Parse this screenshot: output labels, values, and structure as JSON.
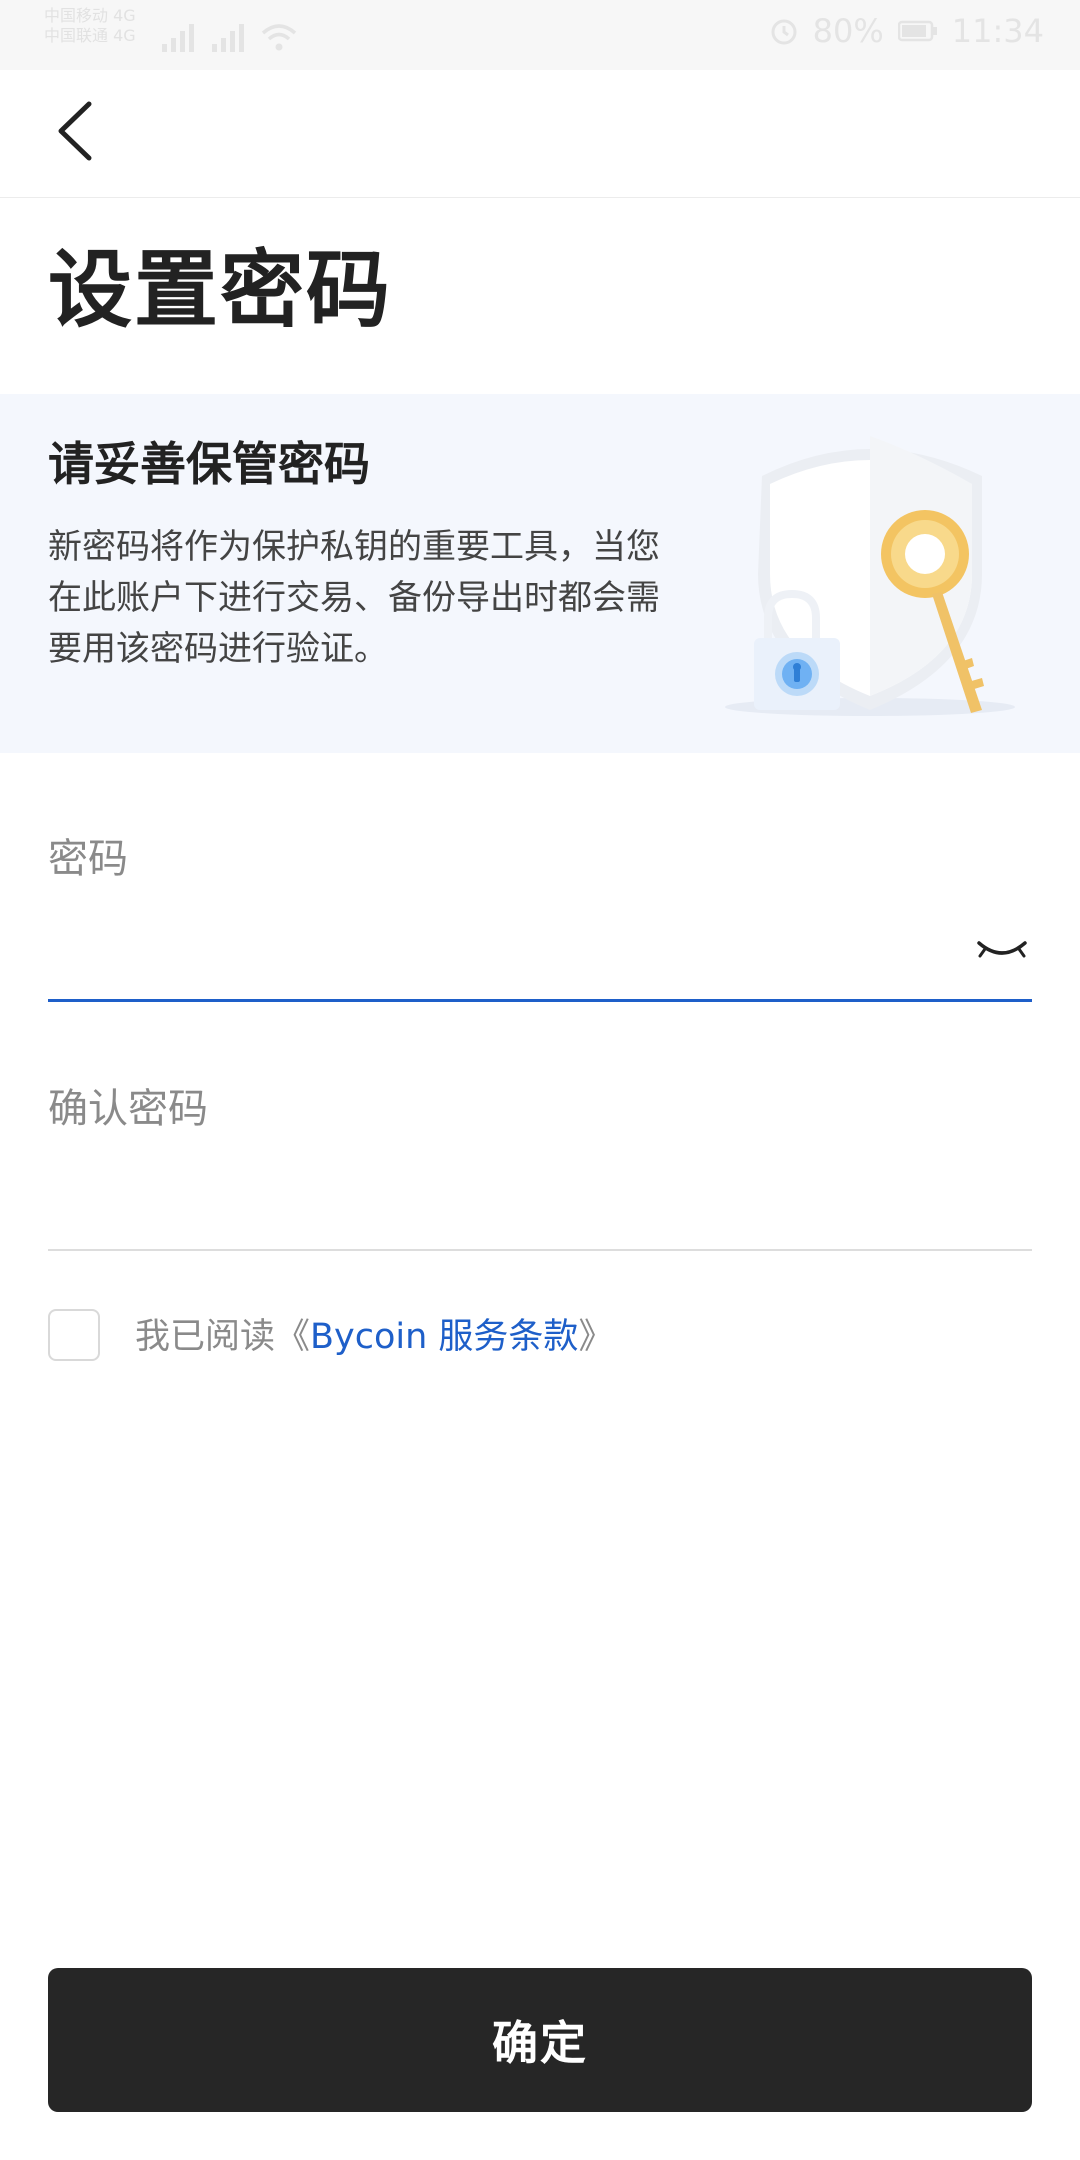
{
  "status_bar": {
    "carrier_line1": "中国移动 4G",
    "carrier_line2": "中国联通 4G",
    "battery": "80%",
    "time": "11:34"
  },
  "nav": {
    "back_icon": "chevron-left-icon"
  },
  "page": {
    "title": "设置密码"
  },
  "info_card": {
    "heading": "请妥善保管密码",
    "body": "新密码将作为保护私钥的重要工具，当您在此账户下进行交易、备份导出时都会需要用该密码进行验证。",
    "illustration_icon": "shield-key-lock-icon"
  },
  "form": {
    "password_label": "密码",
    "password_value": "",
    "confirm_label": "确认密码",
    "confirm_value": "",
    "eye_icon": "eye-closed-icon",
    "accent_color": "#1e5fc9"
  },
  "terms": {
    "prefix": "我已阅读《",
    "link": "Bycoin 服务条款",
    "suffix": "》",
    "checked": false
  },
  "actions": {
    "confirm_label": "确定"
  }
}
